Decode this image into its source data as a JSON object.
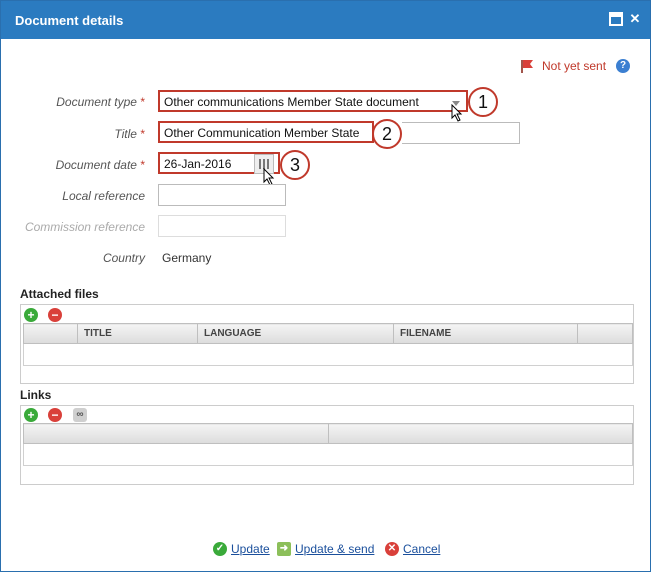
{
  "dialog": {
    "title": "Document details"
  },
  "status": {
    "text": "Not yet sent"
  },
  "form": {
    "document_type": {
      "label": "Document type",
      "required": "*",
      "value": "Other communications Member State document"
    },
    "title": {
      "label": "Title",
      "required": "*",
      "value": "Other Communication Member  State"
    },
    "document_date": {
      "label": "Document date",
      "required": "*",
      "value": "26-Jan-2016"
    },
    "local_reference": {
      "label": "Local reference",
      "value": ""
    },
    "commission_reference": {
      "label": "Commission reference",
      "value": ""
    },
    "country": {
      "label": "Country",
      "value": "Germany"
    }
  },
  "callouts": [
    "1",
    "2",
    "3"
  ],
  "attached_files": {
    "title": "Attached files",
    "columns": [
      "TITLE",
      "LANGUAGE",
      "FILENAME"
    ]
  },
  "links": {
    "title": "Links"
  },
  "footer": {
    "update": "Update",
    "update_send": "Update & send",
    "cancel": "Cancel"
  },
  "colors": {
    "titlebar": "#2b7bc0",
    "highlight": "#c0392b",
    "link": "#1a4f9c"
  }
}
